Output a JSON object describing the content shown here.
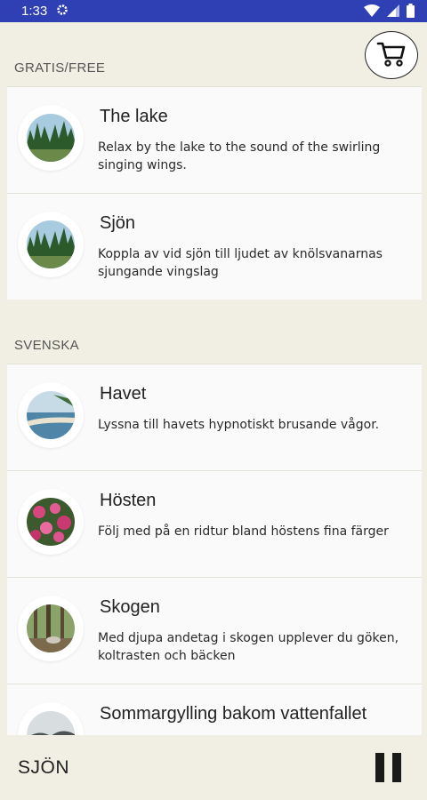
{
  "status_bar": {
    "time": "1:33",
    "icons": [
      "gear-icon",
      "wifi-icon",
      "signal-icon",
      "battery-icon"
    ],
    "bg_color": "#2f3fb4"
  },
  "cart": {
    "icon": "shopping-cart-icon"
  },
  "sections": [
    {
      "label": "GRATIS/FREE",
      "items": [
        {
          "title": "The lake",
          "description": "Relax by the lake to the sound of the swirling singing wings.",
          "thumb": "lake"
        },
        {
          "title": "Sjön",
          "description": "Koppla av vid sjön till ljudet av knölsvanarnas sjungande vingslag",
          "thumb": "lake"
        }
      ]
    },
    {
      "label": "SVENSKA",
      "items": [
        {
          "title": "Havet",
          "description": "Lyssna till havets hypnotiskt brusande vågor.",
          "thumb": "sea"
        },
        {
          "title": "Hösten",
          "description": "Följ med på en ridtur bland höstens fina färger",
          "thumb": "flowers"
        },
        {
          "title": "Skogen",
          "description": "Med djupa andetag i skogen upplever du göken, koltrasten och bäcken",
          "thumb": "forest"
        },
        {
          "title": "Sommargylling bakom vattenfallet",
          "description": "",
          "thumb": "rock"
        }
      ]
    }
  ],
  "player": {
    "title": "SJÖN",
    "pause_icon": "pause-icon"
  },
  "colors": {
    "background": "#f1efe3",
    "row": "#fafafa",
    "status": "#2f3fb4"
  }
}
